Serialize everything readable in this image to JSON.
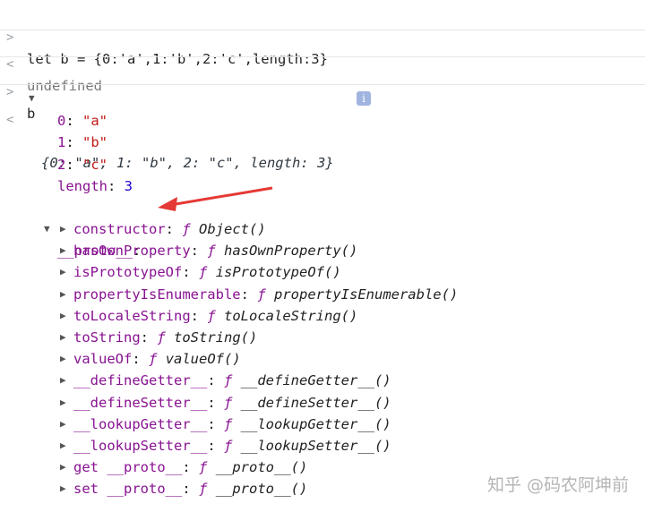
{
  "console": {
    "input1": "let b = {0:'a',1:'b',2:'c',length:3}",
    "output1": "undefined",
    "input2": "b",
    "object_preview": "{0: \"a\", 1: \"b\", 2: \"c\", length: 3}",
    "props": [
      {
        "key": "0",
        "value": "\"a\""
      },
      {
        "key": "1",
        "value": "\"b\""
      },
      {
        "key": "2",
        "value": "\"c\""
      },
      {
        "key": "length",
        "value": "3"
      }
    ],
    "proto_label": "__proto__",
    "proto_items": [
      {
        "key": "constructor",
        "f": "ƒ",
        "fn": "Object()"
      },
      {
        "key": "hasOwnProperty",
        "f": "ƒ",
        "fn": "hasOwnProperty()"
      },
      {
        "key": "isPrototypeOf",
        "f": "ƒ",
        "fn": "isPrototypeOf()"
      },
      {
        "key": "propertyIsEnumerable",
        "f": "ƒ",
        "fn": "propertyIsEnumerable()"
      },
      {
        "key": "toLocaleString",
        "f": "ƒ",
        "fn": "toLocaleString()"
      },
      {
        "key": "toString",
        "f": "ƒ",
        "fn": "toString()"
      },
      {
        "key": "valueOf",
        "f": "ƒ",
        "fn": "valueOf()"
      },
      {
        "key": "__defineGetter__",
        "f": "ƒ",
        "fn": "__defineGetter__()"
      },
      {
        "key": "__defineSetter__",
        "f": "ƒ",
        "fn": "__defineSetter__()"
      },
      {
        "key": "__lookupGetter__",
        "f": "ƒ",
        "fn": "__lookupGetter__()"
      },
      {
        "key": "__lookupSetter__",
        "f": "ƒ",
        "fn": "__lookupSetter__()"
      },
      {
        "key": "get __proto__",
        "f": "ƒ",
        "fn": "__proto__()"
      },
      {
        "key": "set __proto__",
        "f": "ƒ",
        "fn": "__proto__()"
      }
    ]
  },
  "icons": {
    "prompt": ">",
    "result": "<",
    "expanded": "▼",
    "collapsed": "▶",
    "info": "i"
  },
  "colors": {
    "arrow": "#e53935",
    "key": "#881391",
    "string": "#c41a16",
    "number": "#1c00cf"
  },
  "watermark": "知乎 @码农阿坤前"
}
